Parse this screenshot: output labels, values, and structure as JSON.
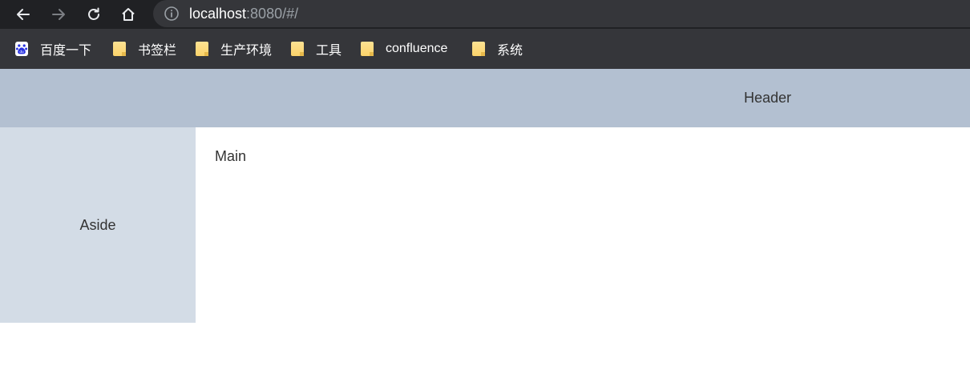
{
  "browser": {
    "nav_icons": [
      "back-arrow-icon",
      "forward-arrow-icon",
      "reload-icon",
      "home-icon"
    ],
    "url_host": "localhost",
    "url_rest": ":8080/#/"
  },
  "bookmarks": [
    {
      "label": "百度一下",
      "icon": "baidu-icon"
    },
    {
      "label": "书签栏",
      "icon": "folder-icon"
    },
    {
      "label": "生产环境",
      "icon": "folder-icon"
    },
    {
      "label": "工具",
      "icon": "folder-icon"
    },
    {
      "label": "confluence",
      "icon": "folder-icon"
    },
    {
      "label": "系统",
      "icon": "folder-icon"
    }
  ],
  "layout": {
    "header": "Header",
    "aside": "Aside",
    "main": "Main"
  },
  "colors": {
    "header_bg": "#b3c0d1",
    "aside_bg": "#d3dce6",
    "main_bg": "#ffffff",
    "text": "#333333"
  }
}
